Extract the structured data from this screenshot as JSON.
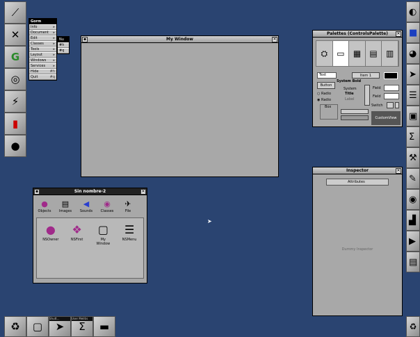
{
  "menu": {
    "title": "Gorm",
    "items": [
      {
        "label": "Info",
        "key": "▸"
      },
      {
        "label": "Document",
        "key": "▸"
      },
      {
        "label": "Edit",
        "key": "▸"
      },
      {
        "label": "Classes",
        "key": "▸"
      },
      {
        "label": "Tools",
        "key": "▸"
      },
      {
        "label": "Layout",
        "key": "▸"
      },
      {
        "label": "Windows",
        "key": "▸"
      },
      {
        "label": "Services",
        "key": "▸"
      },
      {
        "label": "Hide",
        "key": "#h"
      },
      {
        "label": "Quit",
        "key": "#q"
      }
    ],
    "submenu_title": "Nu",
    "submenu_items": [
      "#h",
      "#q"
    ]
  },
  "windows": {
    "my_window": {
      "title": "My Window"
    },
    "palettes": {
      "title": "Palettes (ControlsPalette)"
    },
    "inspector": {
      "title": "Inspector",
      "popup": "Attributes",
      "placeholder": "Dummy Inspector"
    },
    "document": {
      "title": "Sin nombre-2"
    }
  },
  "palette": {
    "text_field": "Text",
    "item_popup": "Item 1",
    "button": "Button",
    "system_bold": "System Bold",
    "system": "System",
    "title": "Title",
    "label": "Label",
    "radio1": "Radio",
    "radio2": "Radio",
    "box": "Box",
    "field1": "Field",
    "field2": "Field",
    "switch": "Switch",
    "custom_view": "CustomView",
    "popup_label": "Item 1"
  },
  "document": {
    "tabs": [
      {
        "label": "Objects",
        "icon": "objects-icon"
      },
      {
        "label": "Images",
        "icon": "images-icon"
      },
      {
        "label": "Sounds",
        "icon": "sounds-icon"
      },
      {
        "label": "Classes",
        "icon": "classes-icon"
      },
      {
        "label": "File",
        "icon": "file-icon"
      }
    ],
    "objects": [
      {
        "label": "NSOwner"
      },
      {
        "label": "NSFirst"
      },
      {
        "label": "My Window"
      },
      {
        "label": "NSMenu"
      }
    ]
  },
  "bottom_bar": {
    "labels": [
      "Shutt...",
      "User Melitis"
    ]
  }
}
